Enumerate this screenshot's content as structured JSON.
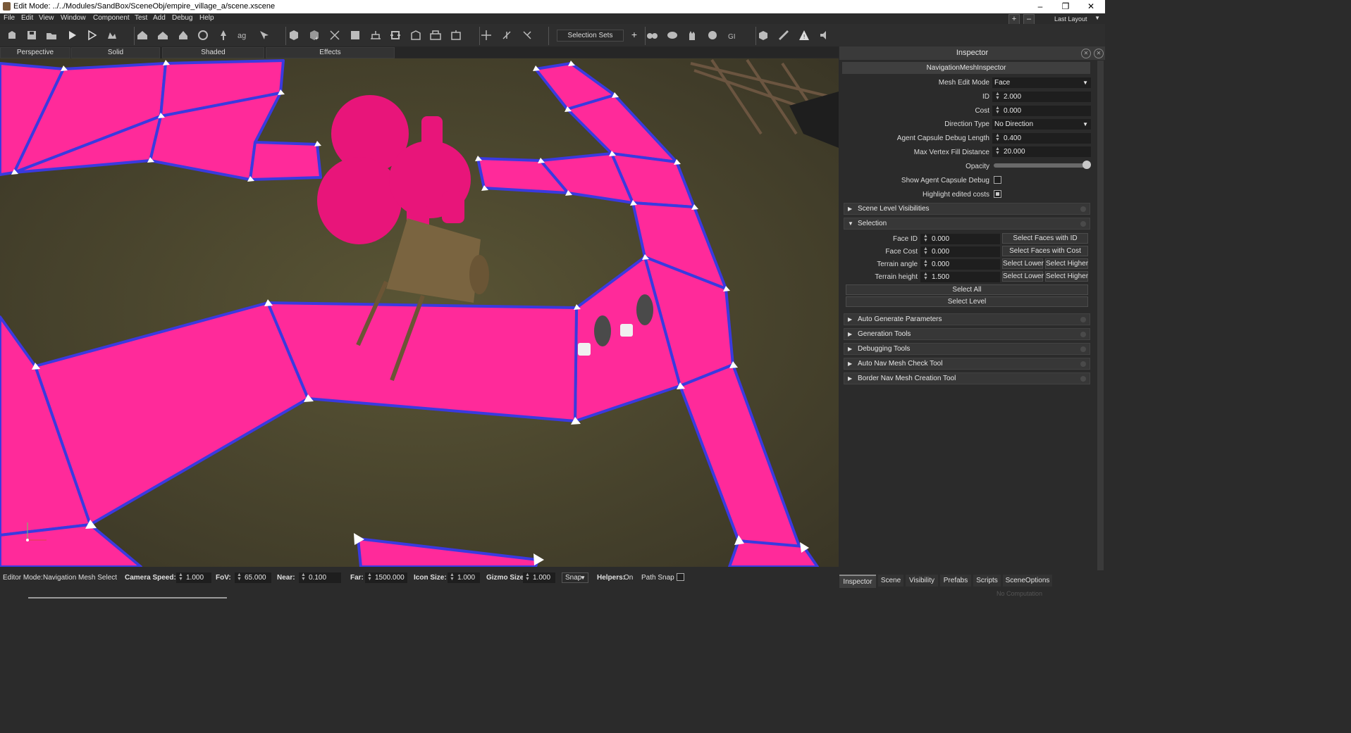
{
  "window": {
    "title": "Edit Mode: ../../Modules/SandBox/SceneObj/empire_village_a/scene.xscene",
    "minimize": "–",
    "restore": "❐",
    "close": "✕"
  },
  "menu": [
    "File",
    "Edit",
    "View",
    "Window",
    "Component",
    "Test",
    "Add",
    "Debug",
    "Help"
  ],
  "layout": {
    "plus": "+",
    "minus": "–",
    "selected": "Last Layout"
  },
  "toolbar": {
    "selection_sets": "Selection Sets",
    "plus": "+",
    "icons": [
      "prefab-icon",
      "save-icon",
      "open-icon",
      "play-icon",
      "play-outline-icon",
      "run-icon",
      "house-icon",
      "house2-icon",
      "house3-icon",
      "path-icon",
      "tree-icon",
      "ag-icon",
      "cursor-icon",
      "cube-icon",
      "cube-add-icon",
      "branch-icon",
      "cube2-icon",
      "mesh-icon",
      "puzzle-icon",
      "grid-icon",
      "grid2-icon",
      "grid3-icon",
      "nav-a-icon",
      "nav-b-icon",
      "nav-c-icon",
      "binoculars-icon",
      "cloud-icon",
      "hand-icon",
      "sphere-icon",
      "gi-icon",
      "snapshot-icon",
      "ruler-icon",
      "warning-icon",
      "sound-icon"
    ]
  },
  "view_tabs": [
    "Perspective",
    "Solid",
    "Shaded",
    "Effects"
  ],
  "inspector": {
    "title": "Inspector",
    "component": "NavigationMeshInspector",
    "props": {
      "mesh_edit_mode_label": "Mesh Edit Mode",
      "mesh_edit_mode": "Face",
      "id_label": "ID",
      "id": "2.000",
      "cost_label": "Cost",
      "cost": "0.000",
      "direction_type_label": "Direction Type",
      "direction_type": "No Direction",
      "agent_capsule_label": "Agent Capsule Debug Length",
      "agent_capsule": "0.400",
      "max_vertex_label": "Max Vertex Fill Distance",
      "max_vertex": "20.000",
      "opacity_label": "Opacity",
      "opacity": 1.0,
      "show_capsule_label": "Show Agent Capsule Debug",
      "highlight_label": "Highlight edited costs"
    },
    "sections": {
      "scene_level": "Scene Level Visibilities",
      "selection": "Selection",
      "auto_generate": "Auto Generate Parameters",
      "generation_tools": "Generation Tools",
      "debugging_tools": "Debugging Tools",
      "auto_nav_check": "Auto Nav Mesh Check Tool",
      "border_nav": "Border Nav Mesh Creation Tool"
    },
    "selection": {
      "face_id_label": "Face ID",
      "face_id": "0.000",
      "face_cost_label": "Face Cost",
      "face_cost": "0.000",
      "terrain_angle_label": "Terrain angle",
      "terrain_angle": "0.000",
      "terrain_height_label": "Terrain height",
      "terrain_height": "1.500",
      "select_faces_id": "Select Faces with ID",
      "select_faces_cost": "Select Faces with Cost",
      "select_lower": "Select Lower",
      "select_higher": "Select Higher",
      "select_all": "Select All",
      "select_level": "Select Level"
    }
  },
  "status": {
    "editor_mode_label": "Editor Mode:",
    "editor_mode": "Navigation Mesh Select",
    "camera_speed_label": "Camera Speed:",
    "camera_speed": "1.000",
    "fov_label": "FoV:",
    "fov": "65.000",
    "near_label": "Near:",
    "near": "0.100",
    "far_label": "Far:",
    "far": "1500.000",
    "icon_size_label": "Icon Size:",
    "icon_size": "1.000",
    "gizmo_size_label": "Gizmo Size",
    "gizmo_size": "1.000",
    "snap": "Snap",
    "helpers_label": "Helpers:",
    "helpers": "On",
    "path_snap": "Path Snap"
  },
  "bottom_tabs": [
    "Inspector",
    "Scene",
    "Visibility",
    "Prefabs",
    "Scripts",
    "SceneOptions"
  ],
  "no_computation": "No Computation",
  "colors": {
    "navmesh": "#ff2a9a",
    "navmesh_edge": "#3a3adf",
    "ground": "#4a4630"
  }
}
